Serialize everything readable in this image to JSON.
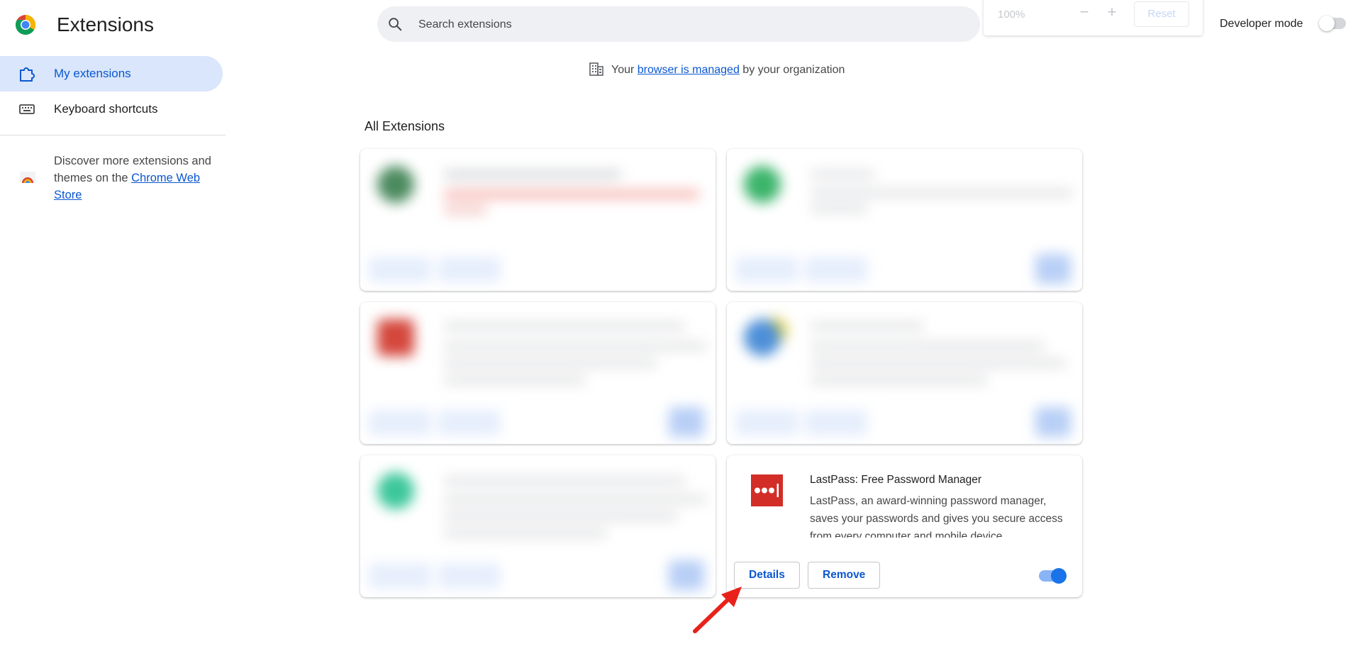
{
  "header": {
    "title": "Extensions",
    "search_placeholder": "Search extensions",
    "zoom": {
      "value": "100%",
      "reset_label": "Reset"
    },
    "developer_mode": {
      "label": "Developer mode",
      "enabled": false
    }
  },
  "sidebar": {
    "items": [
      {
        "label": "My extensions",
        "icon": "puzzle-icon",
        "active": true
      },
      {
        "label": "Keyboard shortcuts",
        "icon": "keyboard-icon",
        "active": false
      }
    ],
    "discover": {
      "text": "Discover more extensions and themes on the ",
      "link_text": "Chrome Web Store",
      "icon": "chrome-web-store-icon"
    }
  },
  "managed_notice": {
    "prefix": "Your ",
    "link_text": "browser is managed",
    "suffix": " by your organization",
    "icon": "building-icon"
  },
  "main": {
    "section_title": "All Extensions",
    "extensions": [
      {
        "name": "LastPass: Free Password Manager",
        "description": "LastPass, an award-winning password manager, saves your passwords and gives you secure access from every computer and mobile device.",
        "details_label": "Details",
        "remove_label": "Remove",
        "enabled": true,
        "icon": "lastpass-icon"
      }
    ]
  },
  "colors": {
    "accent": "#0b57d0",
    "lastpass_red": "#d32d27",
    "annotation_arrow": "#e8221b"
  }
}
